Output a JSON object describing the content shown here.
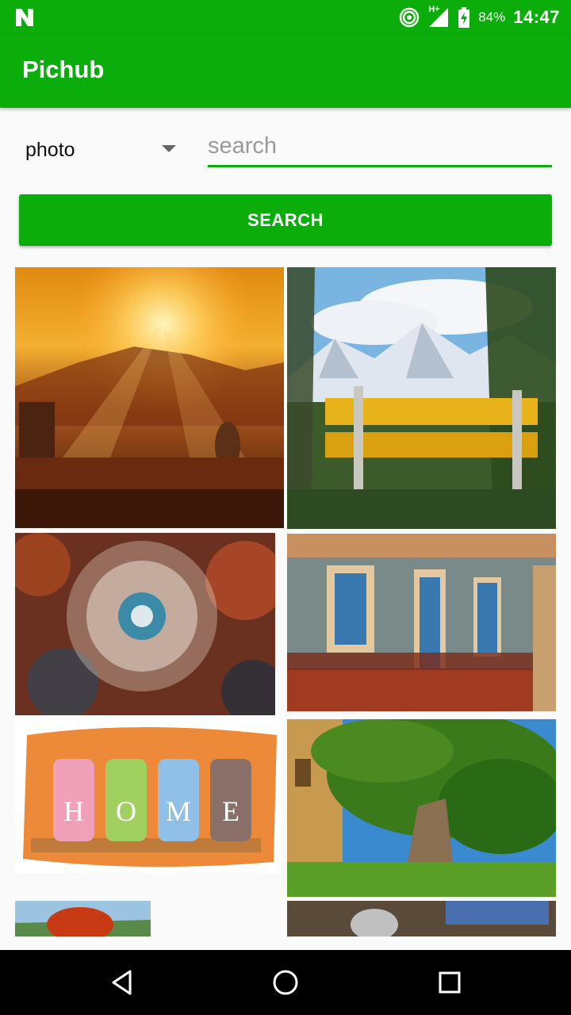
{
  "status": {
    "battery_percent": "84%",
    "time": "14:47",
    "network": "H+",
    "icons": [
      "n-logo-icon",
      "hotspot-icon",
      "signal-icon",
      "battery-charging-icon"
    ]
  },
  "app": {
    "title": "Pichub"
  },
  "search": {
    "type_value": "photo",
    "placeholder": "search",
    "button_label": "SEARCH"
  },
  "results": {
    "images": [
      {
        "subject": "sunset-over-mountains"
      },
      {
        "subject": "yellow-bench-snowy-mountains"
      },
      {
        "subject": "dandelion"
      },
      {
        "subject": "street-cafe-building"
      },
      {
        "subject": "home-vases",
        "text": "HOME",
        "letters": [
          "H",
          "O",
          "M",
          "E"
        ]
      },
      {
        "subject": "large-old-tree"
      },
      {
        "subject": "red-tree-landscape"
      },
      {
        "subject": "blue-fence"
      }
    ]
  },
  "nav": {
    "icons": [
      "back-icon",
      "home-icon",
      "recents-icon"
    ]
  },
  "colors": {
    "accent": "#0aad0a",
    "status_text": "#ffffff",
    "nav_background": "#000000"
  }
}
